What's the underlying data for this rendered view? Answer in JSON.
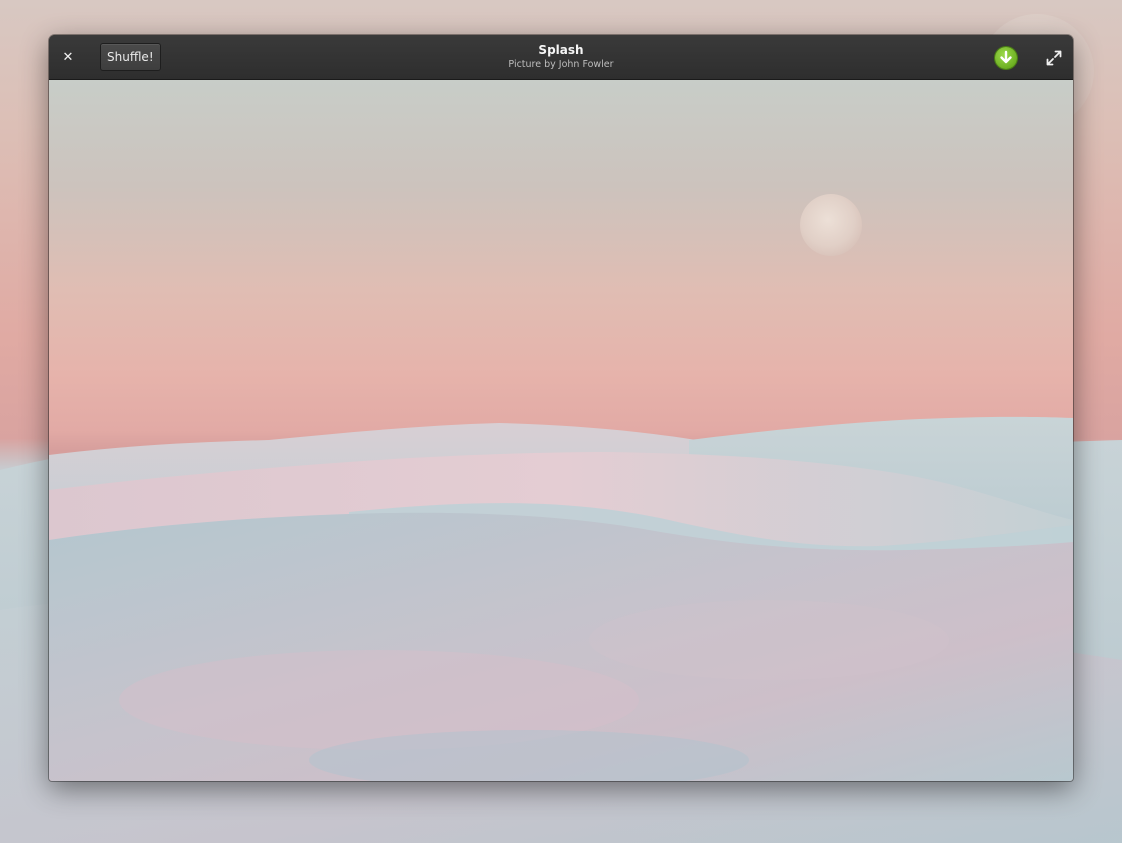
{
  "window": {
    "title": "Splash",
    "subtitle": "Picture by John Fowler"
  },
  "toolbar": {
    "close_icon": "close-icon",
    "close_glyph": "✕",
    "shuffle_label": "Shuffle!",
    "download_icon": "download-icon",
    "fullscreen_icon": "fullscreen-icon"
  },
  "photo": {
    "subject": "white sand dunes under pink sky with moon"
  },
  "colors": {
    "titlebar": "#333333",
    "download_accent": "#7cc12f",
    "sky_top": "#c8cdc8",
    "sky_pink": "#e2aaa5",
    "dune_blue": "#b9c9cf"
  }
}
